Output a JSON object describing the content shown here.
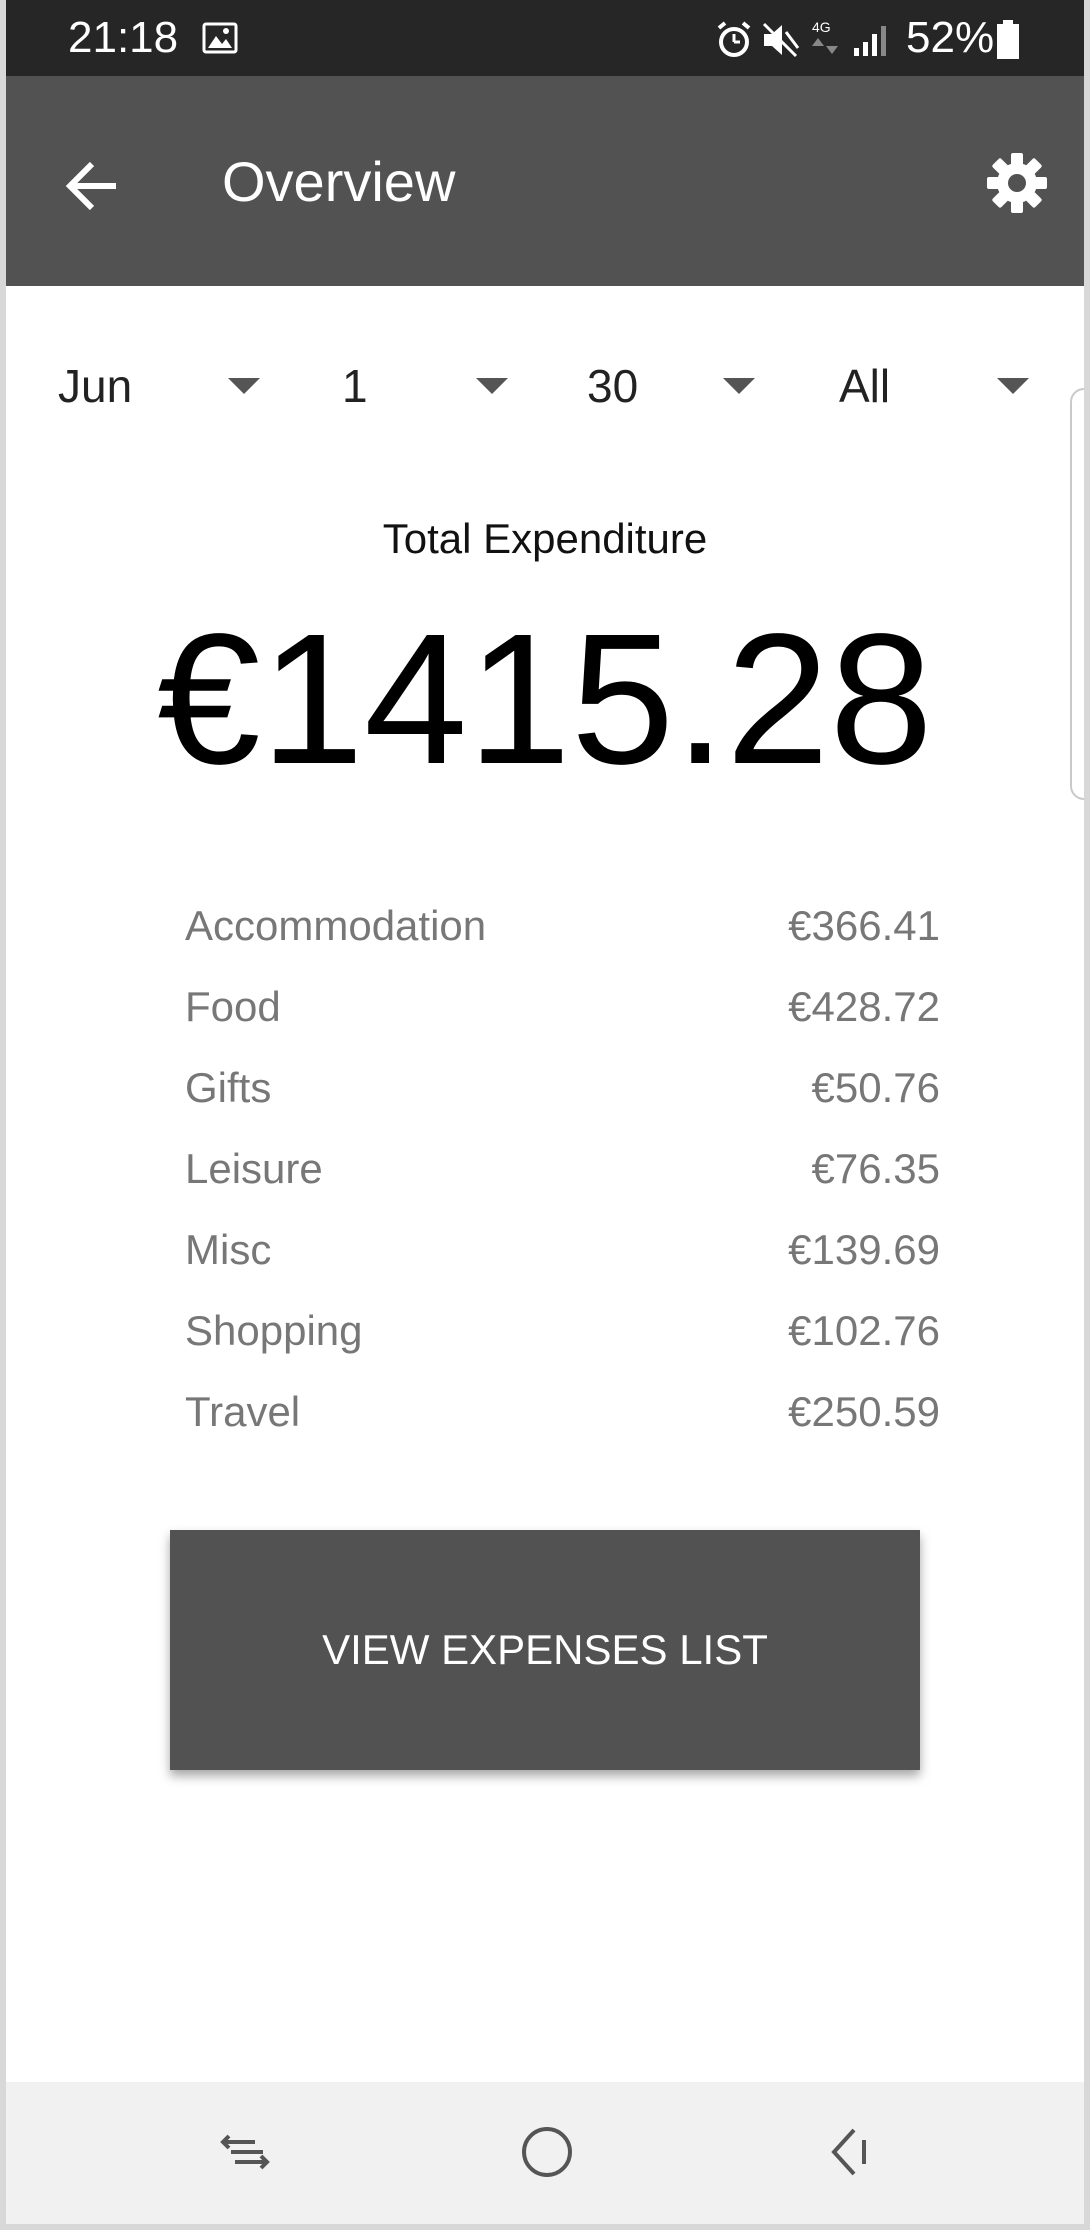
{
  "status_bar": {
    "time": "21:18",
    "battery": "52%",
    "icons": [
      "image-icon",
      "alarm-icon",
      "mute-icon",
      "4g-icon",
      "signal-icon",
      "battery-icon"
    ]
  },
  "app_bar": {
    "title": "Overview",
    "back_icon": "arrow-left-icon",
    "settings_icon": "gear-icon"
  },
  "filters": [
    {
      "label": "Jun"
    },
    {
      "label": "1"
    },
    {
      "label": "30"
    },
    {
      "label": "All"
    }
  ],
  "summary": {
    "title": "Total Expenditure",
    "total": "€1415.28"
  },
  "categories": [
    {
      "name": "Accommodation",
      "amount": "€366.41"
    },
    {
      "name": "Food",
      "amount": "€428.72"
    },
    {
      "name": "Gifts",
      "amount": "€50.76"
    },
    {
      "name": "Leisure",
      "amount": "€76.35"
    },
    {
      "name": "Misc",
      "amount": "€139.69"
    },
    {
      "name": "Shopping",
      "amount": "€102.76"
    },
    {
      "name": "Travel",
      "amount": "€250.59"
    }
  ],
  "actions": {
    "view_expenses": "VIEW EXPENSES LIST"
  },
  "nav_bar": {
    "icons": [
      "recent-apps-icon",
      "home-icon",
      "back-icon"
    ]
  },
  "colors": {
    "app_bar": "#525252",
    "status_bar": "#262626",
    "button": "#525252",
    "category_text": "#777777"
  }
}
